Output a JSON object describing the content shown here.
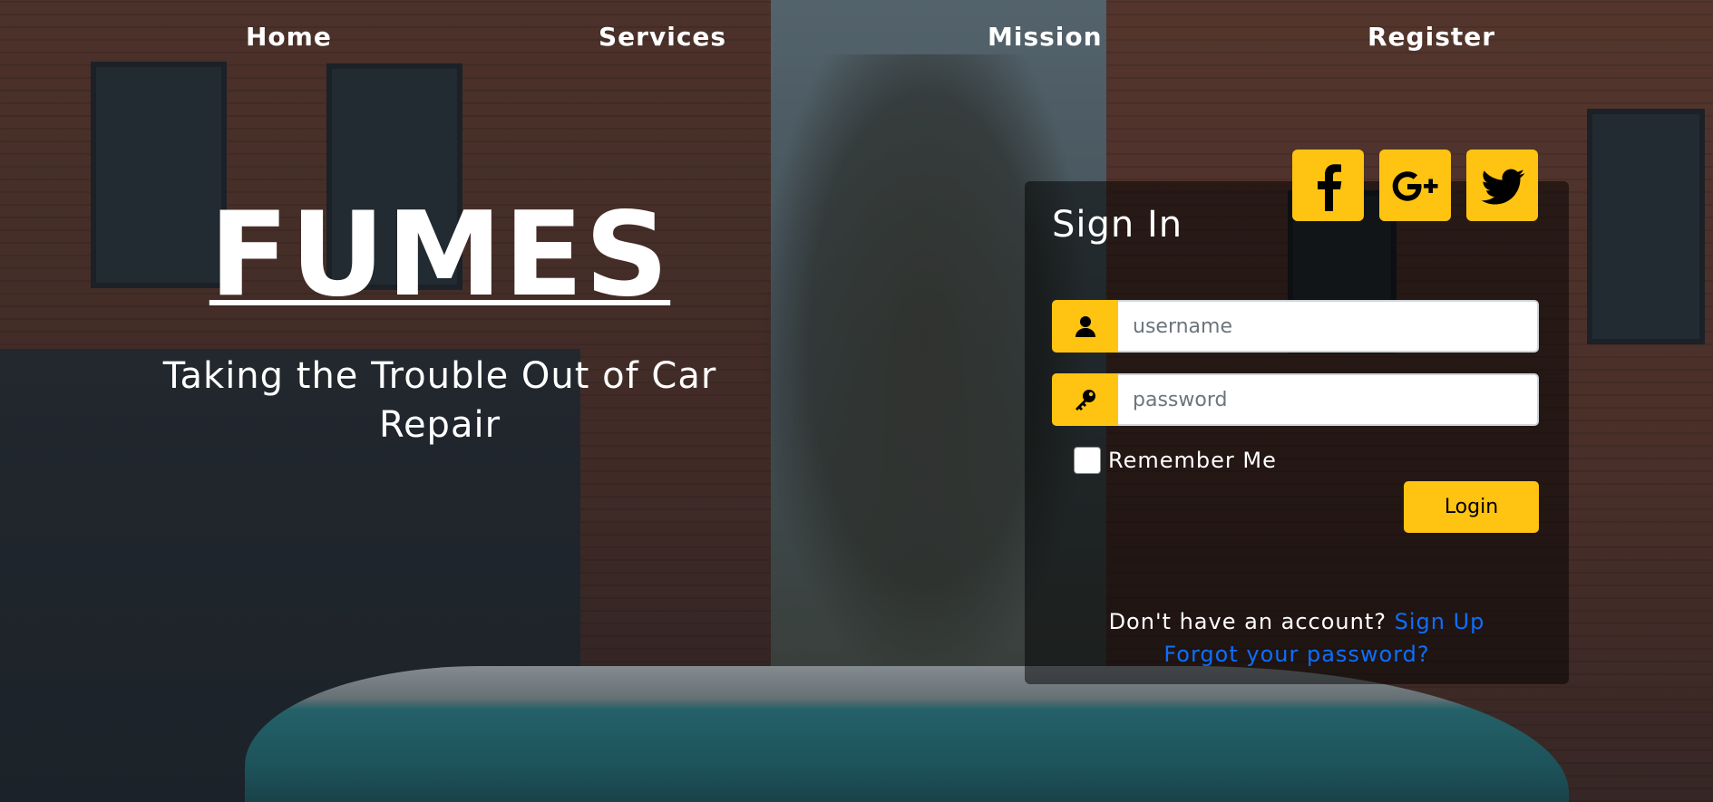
{
  "nav": {
    "items": [
      {
        "label": "Home"
      },
      {
        "label": "Services"
      },
      {
        "label": "Mission"
      },
      {
        "label": "Register"
      }
    ]
  },
  "hero": {
    "brand": "FUMES",
    "tagline": "Taking the Trouble Out of Car Repair"
  },
  "signin": {
    "title": "Sign In",
    "social": [
      {
        "icon": "facebook-icon"
      },
      {
        "icon": "google-plus-icon"
      },
      {
        "icon": "twitter-icon"
      }
    ],
    "username": {
      "icon": "user-icon",
      "placeholder": "username",
      "value": ""
    },
    "password": {
      "icon": "key-icon",
      "placeholder": "password",
      "value": ""
    },
    "remember_label": "Remember Me",
    "remember_checked": false,
    "login_label": "Login",
    "no_account_text": "Don't have an account?",
    "signup_link": "Sign Up",
    "forgot_link": "Forgot your password?"
  },
  "colors": {
    "accent": "#ffc312",
    "link": "#0d6efd",
    "card_bg": "rgba(0,0,0,0.5)"
  }
}
